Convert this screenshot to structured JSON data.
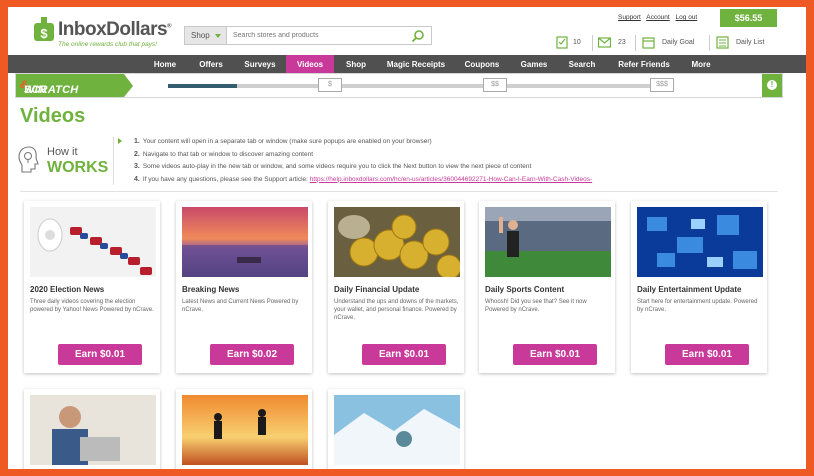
{
  "brand": {
    "name": "InboxDollars",
    "registered": "®",
    "tagline": "The online rewards club that pays!"
  },
  "search": {
    "category": "Shop",
    "placeholder": "Search stores and products"
  },
  "account": {
    "links": [
      "Support",
      "Account",
      "Log out"
    ],
    "balance": "$56.55"
  },
  "stats": {
    "checks": "10",
    "messages": "23",
    "daily_goal": "Daily Goal",
    "daily_list": "Daily List"
  },
  "nav": {
    "items": [
      "Home",
      "Offers",
      "Surveys",
      "Videos",
      "Shop",
      "Magic Receipts",
      "Coupons",
      "Games",
      "Search",
      "Refer Friends",
      "More"
    ],
    "active": "Videos"
  },
  "scratch": {
    "label_a": "SCRATCH",
    "label_amp": "&",
    "label_b": "WIN",
    "tiers": [
      "$",
      "$$",
      "$$$"
    ],
    "progress": 0.14
  },
  "page": {
    "title": "Videos"
  },
  "how": {
    "line1": "How it",
    "line2": "WORKS",
    "steps": [
      "Your content will open in a separate tab or window (make sure popups are enabled on your browser)",
      "Navigate to that tab or window to discover amazing content",
      "Some videos auto-play in the new tab or window, and some videos require you to click the Next button to view the next piece of content",
      "If you have any questions, please see the Support article: "
    ],
    "support_link": "https://help.inboxdollars.com/hc/en-us/articles/360044692271-How-Can-I-Earn-With-Cash-Videos-"
  },
  "cards": [
    {
      "title": "2020 Election News",
      "desc": "Three daily videos covering the election powered by Yahoo! News Powered by nCrave.",
      "earn": "Earn $0.01"
    },
    {
      "title": "Breaking News",
      "desc": "Latest News and Current News Powered by nCrave.",
      "earn": "Earn $0.02"
    },
    {
      "title": "Daily Financial Update",
      "desc": "Understand the ups and downs of the markets, your wallet, and personal finance. Powered by nCrave.",
      "earn": "Earn $0.01"
    },
    {
      "title": "Daily Sports Content",
      "desc": "Whoosh! Did you see that? See it now Powered by nCrave.",
      "earn": "Earn $0.01"
    },
    {
      "title": "Daily Entertainment Update",
      "desc": "Start here for entertainment update. Powered by nCrave.",
      "earn": "Earn $0.01"
    }
  ],
  "colors": {
    "green": "#6fb23d",
    "magenta": "#c8399a",
    "orange": "#ef5a24",
    "nav": "#505050"
  }
}
